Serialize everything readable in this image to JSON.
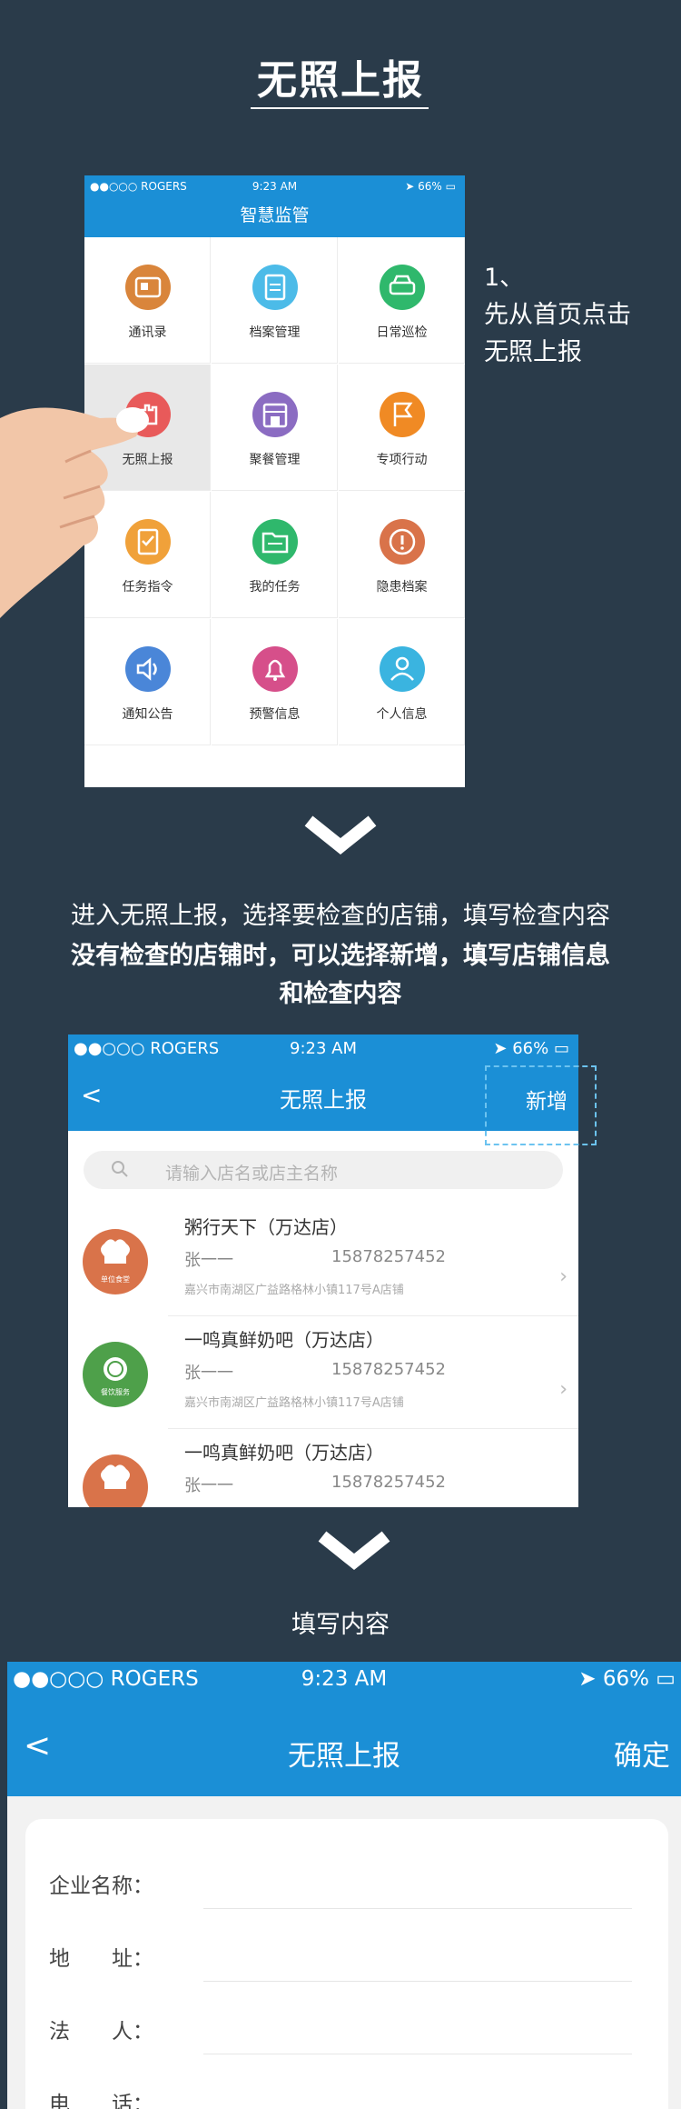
{
  "title": "无照上报",
  "step1": {
    "number": "1、",
    "line1": "先从首页点击",
    "line2": "无照上报"
  },
  "screen1": {
    "status": {
      "carrier": "●●○○○ ROGERS",
      "time": "9:23 AM",
      "battery": "66%"
    },
    "nav_title": "智慧监管",
    "grid": [
      {
        "label": "通讯录",
        "icon": "contacts-icon",
        "color": "#d9853b"
      },
      {
        "label": "档案管理",
        "icon": "clipboard-icon",
        "color": "#4cbbe8"
      },
      {
        "label": "日常巡检",
        "icon": "car-icon",
        "color": "#2fb86c"
      },
      {
        "label": "无照上报",
        "icon": "hand-report-icon",
        "color": "#e85a5a"
      },
      {
        "label": "聚餐管理",
        "icon": "storefront-icon",
        "color": "#8b6cc2"
      },
      {
        "label": "专项行动",
        "icon": "flag-icon",
        "color": "#f08a24"
      },
      {
        "label": "任务指令",
        "icon": "task-clipboard-icon",
        "color": "#f0a13a"
      },
      {
        "label": "我的任务",
        "icon": "folder-icon",
        "color": "#2fb86c"
      },
      {
        "label": "隐患档案",
        "icon": "warning-icon",
        "color": "#d9734a"
      },
      {
        "label": "通知公告",
        "icon": "speaker-icon",
        "color": "#4a86d8"
      },
      {
        "label": "预警信息",
        "icon": "bell-icon",
        "color": "#d64f8a"
      },
      {
        "label": "个人信息",
        "icon": "person-icon",
        "color": "#3ab4e0"
      }
    ]
  },
  "desc1": "进入无照上报，选择要检查的店铺，填写检查内容",
  "desc2_line1": "没有检查的店铺时，可以选择新增，填写店铺信息",
  "desc2_line2": "和检查内容",
  "screen2": {
    "status": {
      "carrier": "●●○○○ ROGERS",
      "time": "9:23 AM",
      "battery": "66%"
    },
    "nav_title": "无照上报",
    "add_label": "新增",
    "search_placeholder": "请输入店名或店主名称",
    "stores": [
      {
        "name": "粥行天下（万达店）",
        "person": "张一一",
        "phone": "15878257452",
        "address": "嘉兴市南湖区广益路格林小镇117号A店铺",
        "badge": "单位食堂",
        "color": "#d9734a",
        "icon": "chef-hat-icon"
      },
      {
        "name": "一鸣真鲜奶吧（万达店）",
        "person": "张一一",
        "phone": "15878257452",
        "address": "嘉兴市南湖区广益路格林小镇117号A店铺",
        "badge": "餐饮服务",
        "color": "#4ea04a",
        "icon": "plate-icon"
      },
      {
        "name": "一鸣真鲜奶吧（万达店）",
        "person": "张一一",
        "phone": "15878257452",
        "address": "",
        "badge": "",
        "color": "#d9734a",
        "icon": "chef-hat-icon"
      }
    ]
  },
  "desc3": "填写内容",
  "screen3": {
    "status": {
      "carrier": "●●○○○ ROGERS",
      "time": "9:23 AM",
      "battery": "66%"
    },
    "nav_title": "无照上报",
    "confirm_label": "确定",
    "fields": [
      "企业名称：",
      "地　　址：",
      "法　　人：",
      "电　　话："
    ]
  }
}
